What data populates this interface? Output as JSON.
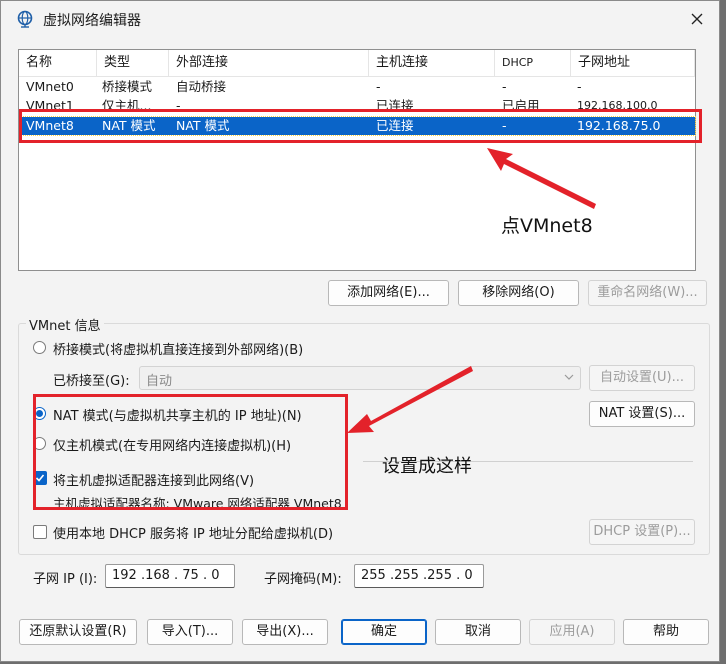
{
  "window": {
    "title": "虚拟网络编辑器"
  },
  "table": {
    "columns": [
      "名称",
      "类型",
      "外部连接",
      "主机连接",
      "DHCP",
      "子网地址"
    ],
    "rows": [
      {
        "name": "VMnet0",
        "type": "桥接模式",
        "external": "自动桥接",
        "host": "-",
        "dhcp": "-",
        "subnet": "-"
      },
      {
        "name": "VMnet1",
        "type": "仅主机...",
        "external": "-",
        "host": "已连接",
        "dhcp": "已启用",
        "subnet": "192.168.100.0"
      },
      {
        "name": "VMnet8",
        "type": "NAT 模式",
        "external": "NAT 模式",
        "host": "已连接",
        "dhcp": "-",
        "subnet": "192.168.75.0",
        "selected": true
      }
    ]
  },
  "list_buttons": {
    "add": "添加网络(E)...",
    "remove": "移除网络(O)",
    "rename": "重命名网络(W)..."
  },
  "vmnet_info": {
    "title": "VMnet 信息",
    "bridged_label": "桥接模式(将虚拟机直接连接到外部网络)(B)",
    "bridged_to_label": "已桥接至(G):",
    "bridged_to_value": "自动",
    "auto_settings": "自动设置(U)...",
    "nat_label": "NAT 模式(与虚拟机共享主机的 IP 地址)(N)",
    "nat_settings": "NAT 设置(S)...",
    "hostonly_label": "仅主机模式(在专用网络内连接虚拟机)(H)",
    "connect_adapter_label": "将主机虚拟适配器连接到此网络(V)",
    "adapter_name_label": "主机虚拟适配器名称: VMware 网络适配器 VMnet8",
    "dhcp_label": "使用本地 DHCP 服务将 IP 地址分配给虚拟机(D)",
    "dhcp_settings": "DHCP 设置(P)...",
    "selected_mode": "nat",
    "connect_adapter_checked": true,
    "dhcp_checked": false
  },
  "subnet": {
    "ip_label": "子网 IP (I):",
    "ip_value": "192 .168 . 75 . 0",
    "mask_label": "子网掩码(M):",
    "mask_value": "255 .255 .255 . 0"
  },
  "footer": {
    "restore": "还原默认设置(R)",
    "import": "导入(T)...",
    "export": "导出(X)...",
    "ok": "确定",
    "cancel": "取消",
    "apply": "应用(A)",
    "help": "帮助"
  },
  "annotations": {
    "click_note": "点VMnet8",
    "set_note": "设置成这样",
    "color": "#e3222a"
  },
  "colors": {
    "accent": "#0a64c8",
    "annotation": "#e3222a"
  }
}
